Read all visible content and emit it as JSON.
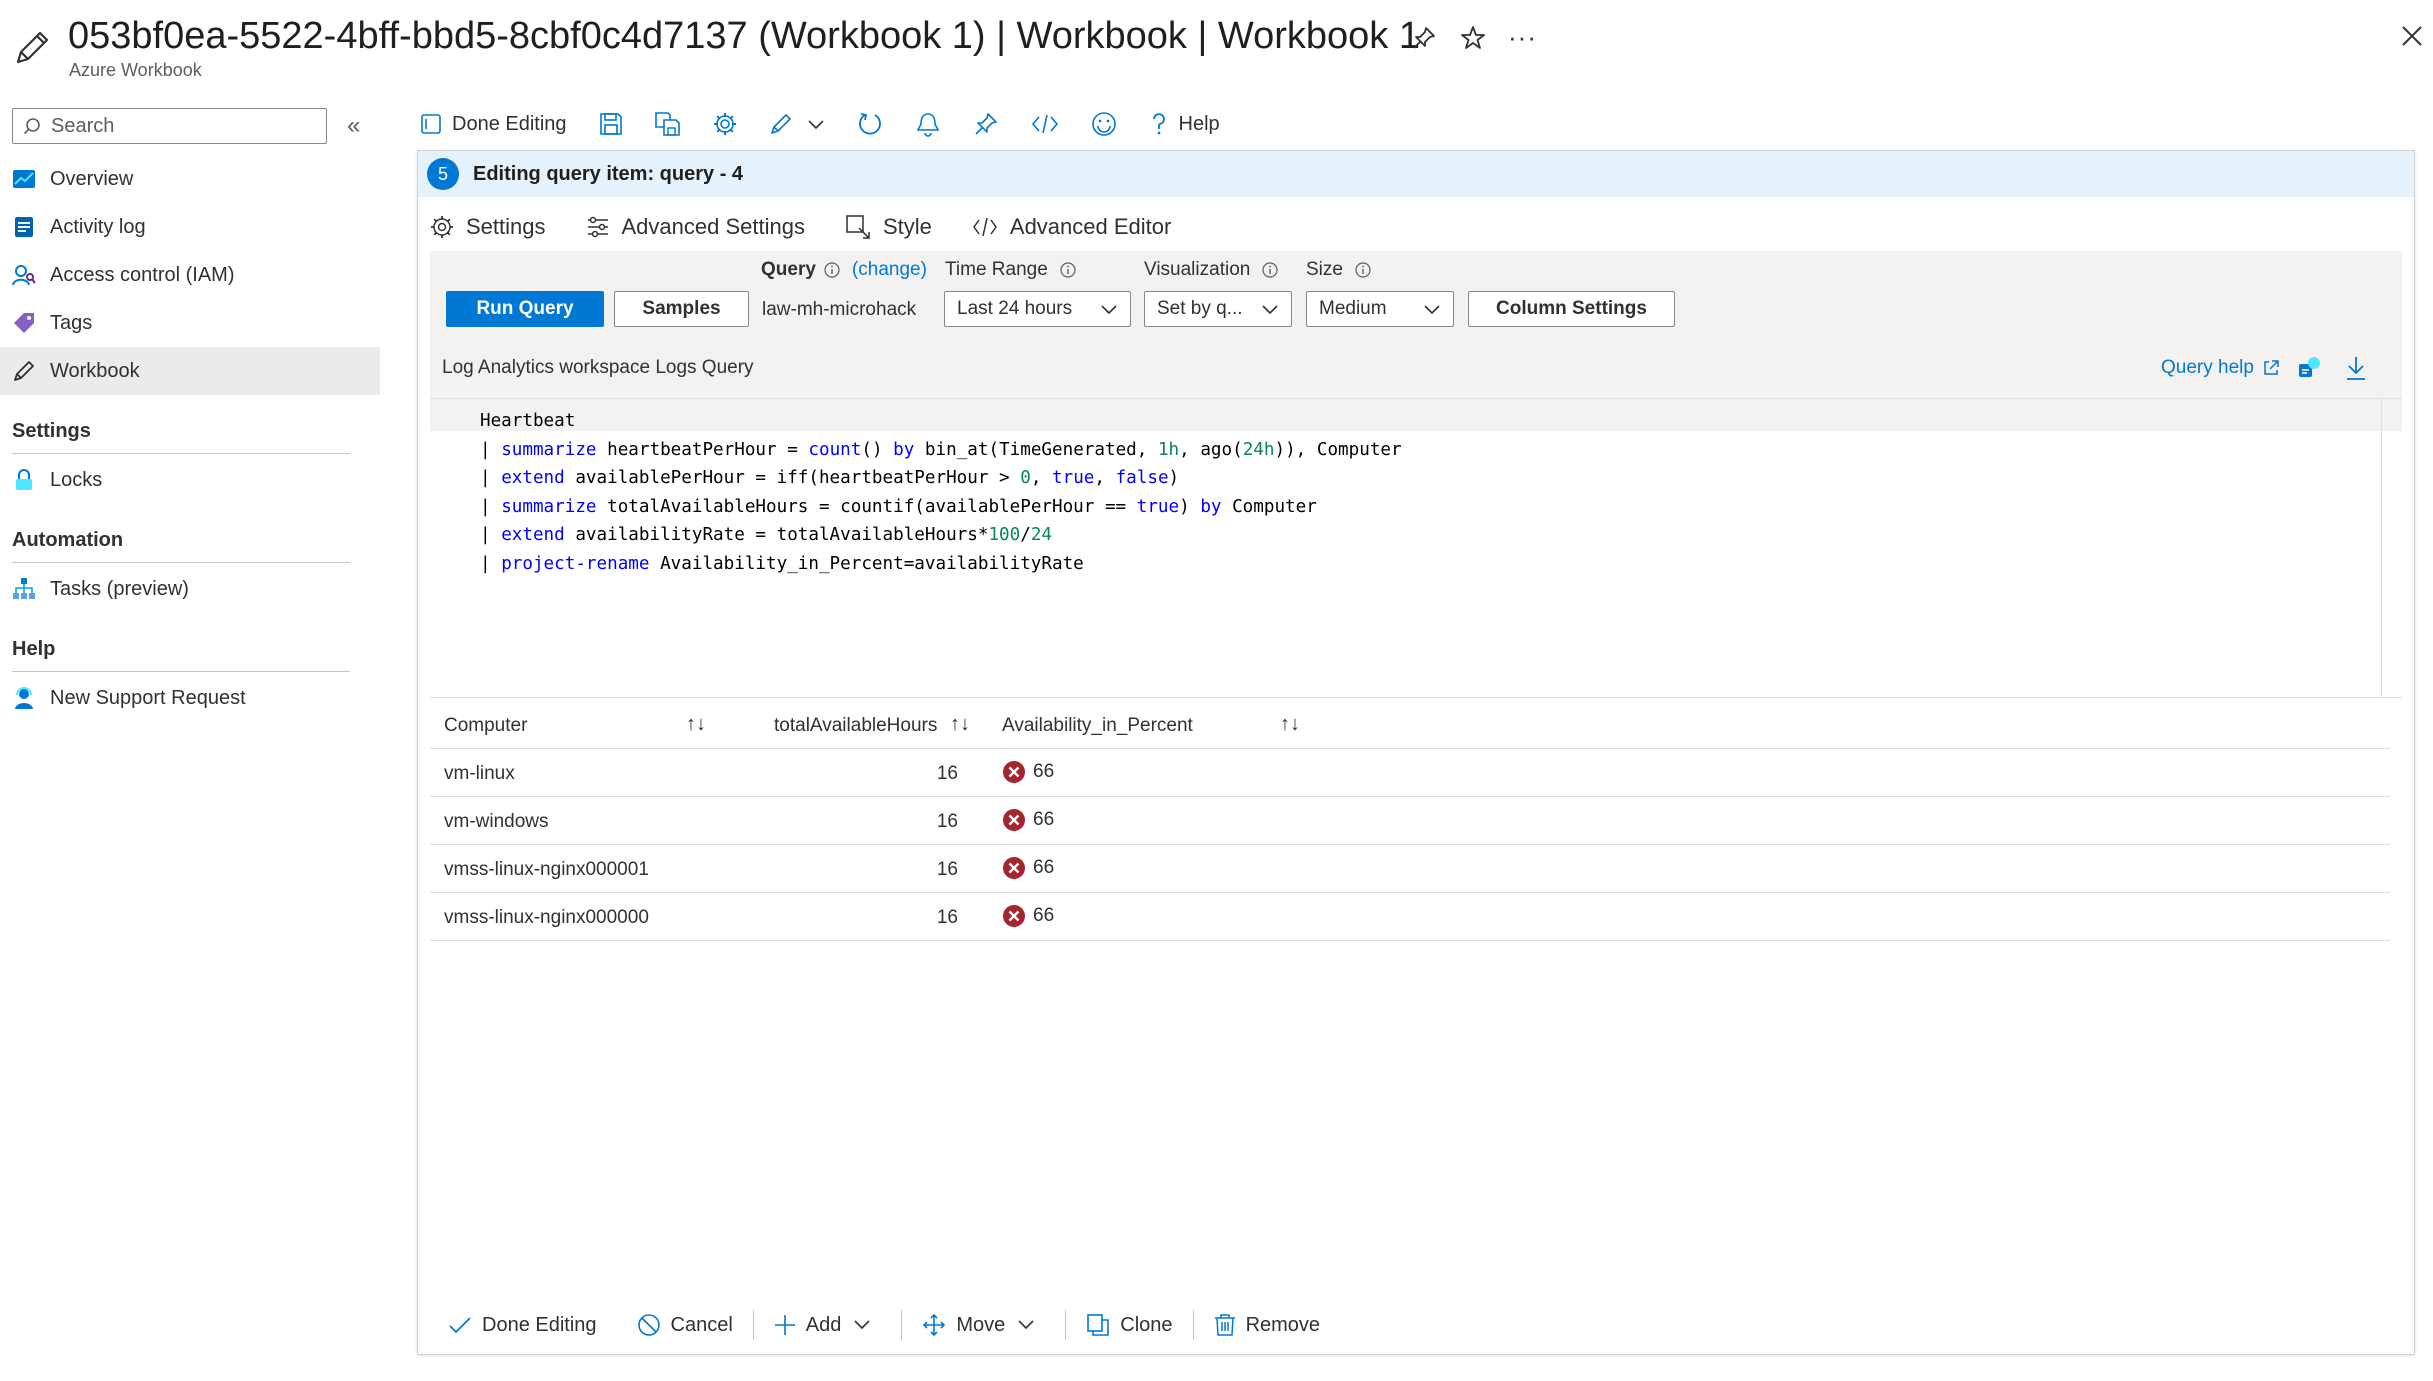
{
  "title_bar": {
    "title": "053bf0ea-5522-4bff-bbd5-8cbf0c4d7137 (Workbook 1) | Workbook | Workbook 1",
    "subtitle": "Azure Workbook",
    "more_label": "···"
  },
  "sidebar": {
    "search_placeholder": "Search",
    "collapse_label": "«",
    "items": [
      {
        "label": "Overview",
        "icon": "overview-icon"
      },
      {
        "label": "Activity log",
        "icon": "activity-log-icon"
      },
      {
        "label": "Access control (IAM)",
        "icon": "iam-icon"
      },
      {
        "label": "Tags",
        "icon": "tag-icon"
      },
      {
        "label": "Workbook",
        "icon": "pencil-icon",
        "selected": true
      }
    ],
    "sections": [
      {
        "title": "Settings",
        "items": [
          {
            "label": "Locks",
            "icon": "lock-icon"
          }
        ]
      },
      {
        "title": "Automation",
        "items": [
          {
            "label": "Tasks (preview)",
            "icon": "tasks-icon"
          }
        ]
      },
      {
        "title": "Help",
        "items": [
          {
            "label": "New Support Request",
            "icon": "support-icon"
          }
        ]
      }
    ]
  },
  "command_bar": {
    "done_editing": "Done Editing",
    "help": "Help"
  },
  "editor": {
    "step_number": "5",
    "header": "Editing query item: query - 4",
    "tabs": [
      "Settings",
      "Advanced Settings",
      "Style",
      "Advanced Editor"
    ],
    "active_tab": "Settings",
    "run_query": "Run Query",
    "samples": "Samples",
    "query_label": "Query",
    "change_link": "(change)",
    "workspace": "law-mh-microhack",
    "time_range_label": "Time Range",
    "time_range_value": "Last 24 hours",
    "visualization_label": "Visualization",
    "visualization_value": "Set by q...",
    "size_label": "Size",
    "size_value": "Medium",
    "column_settings": "Column Settings",
    "logs_query_label": "Log Analytics workspace Logs Query",
    "query_help": "Query help"
  },
  "code": {
    "line1": "Heartbeat",
    "line2": [
      {
        "t": "| ",
        "c": "pipe"
      },
      {
        "t": "summarize",
        "c": "kw"
      },
      {
        "t": " heartbeatPerHour = ",
        "c": ""
      },
      {
        "t": "count",
        "c": "kw"
      },
      {
        "t": "() ",
        "c": ""
      },
      {
        "t": "by",
        "c": "kw"
      },
      {
        "t": " bin_at(TimeGenerated, ",
        "c": ""
      },
      {
        "t": "1h",
        "c": "num"
      },
      {
        "t": ", ago(",
        "c": ""
      },
      {
        "t": "24h",
        "c": "num"
      },
      {
        "t": ")), Computer",
        "c": ""
      }
    ],
    "line3": [
      {
        "t": "| ",
        "c": "pipe"
      },
      {
        "t": "extend",
        "c": "kw"
      },
      {
        "t": " availablePerHour = iff(heartbeatPerHour > ",
        "c": ""
      },
      {
        "t": "0",
        "c": "num"
      },
      {
        "t": ", ",
        "c": ""
      },
      {
        "t": "true",
        "c": "kw"
      },
      {
        "t": ", ",
        "c": ""
      },
      {
        "t": "false",
        "c": "kw"
      },
      {
        "t": ")",
        "c": ""
      }
    ],
    "line4": [
      {
        "t": "| ",
        "c": "pipe"
      },
      {
        "t": "summarize",
        "c": "kw"
      },
      {
        "t": " totalAvailableHours = countif(availablePerHour == ",
        "c": ""
      },
      {
        "t": "true",
        "c": "kw"
      },
      {
        "t": ") ",
        "c": ""
      },
      {
        "t": "by",
        "c": "kw"
      },
      {
        "t": " Computer",
        "c": ""
      }
    ],
    "line5": [
      {
        "t": "| ",
        "c": "pipe"
      },
      {
        "t": "extend",
        "c": "kw"
      },
      {
        "t": " availabilityRate = totalAvailableHours*",
        "c": ""
      },
      {
        "t": "100",
        "c": "num"
      },
      {
        "t": "/",
        "c": ""
      },
      {
        "t": "24",
        "c": "num"
      }
    ],
    "line6": [
      {
        "t": "| ",
        "c": "pipe"
      },
      {
        "t": "project-rename",
        "c": "kw"
      },
      {
        "t": " Availability_in_Percent=availabilityRate",
        "c": ""
      }
    ]
  },
  "results": {
    "columns": [
      "Computer",
      "totalAvailableHours",
      "Availability_in_Percent"
    ],
    "sort_glyph": "↑↓",
    "rows": [
      {
        "computer": "vm-linux",
        "hours": "16",
        "percent": "66"
      },
      {
        "computer": "vm-windows",
        "hours": "16",
        "percent": "66"
      },
      {
        "computer": "vmss-linux-nginx000001",
        "hours": "16",
        "percent": "66"
      },
      {
        "computer": "vmss-linux-nginx000000",
        "hours": "16",
        "percent": "66"
      }
    ]
  },
  "bottom_bar": {
    "done_editing": "Done Editing",
    "cancel": "Cancel",
    "add": "Add",
    "move": "Move",
    "clone": "Clone",
    "remove": "Remove"
  },
  "colors": {
    "accent": "#0078d4",
    "error": "#a4262c",
    "keyword": "#0000ff",
    "number": "#098658"
  }
}
